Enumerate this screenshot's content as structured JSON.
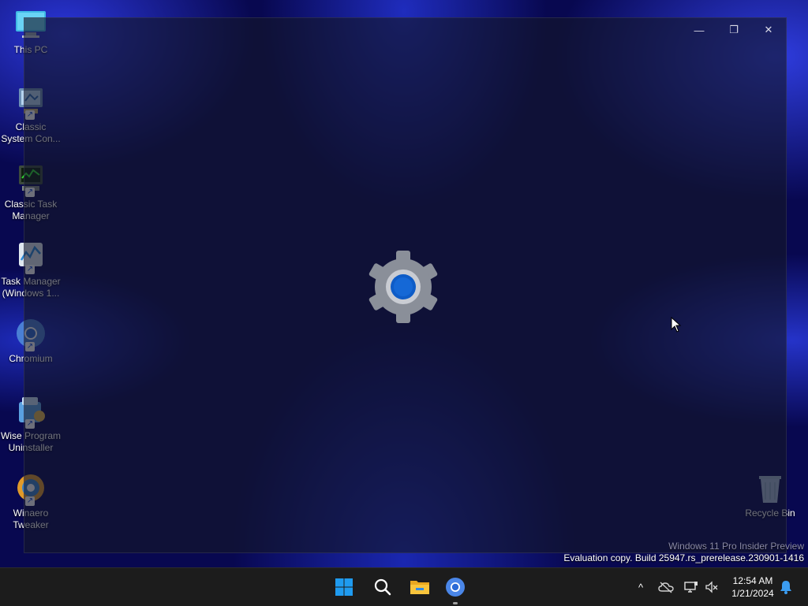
{
  "desktop": {
    "icons": [
      {
        "label": "This PC",
        "icon": "this-pc-icon"
      },
      {
        "label": "Classic System Con...",
        "icon": "control-panel-icon"
      },
      {
        "label": "Classic Task Manager",
        "icon": "classic-task-manager-icon"
      },
      {
        "label": "Task Manager (Windows 1...",
        "icon": "task-manager-icon"
      },
      {
        "label": "Chromium",
        "icon": "chromium-icon"
      },
      {
        "label": "Wise Program Uninstaller",
        "icon": "uninstaller-icon"
      },
      {
        "label": "Winaero Tweaker",
        "icon": "winaero-icon"
      }
    ],
    "recycle_bin": {
      "label": "Recycle Bin",
      "icon": "recycle-bin-icon"
    }
  },
  "window": {
    "app": "Settings",
    "splash_icon": "settings-gear-icon",
    "controls": {
      "minimize": "—",
      "restore": "❐",
      "close": "✕"
    }
  },
  "watermark": {
    "line1": "Windows 11 Pro Insider Preview",
    "line2": "Evaluation copy. Build 25947.rs_prerelease.230901-1416"
  },
  "taskbar": {
    "pinned": [
      {
        "name": "Start",
        "icon": "windows-start-icon"
      },
      {
        "name": "Search",
        "icon": "search-icon"
      },
      {
        "name": "File Explorer",
        "icon": "file-explorer-icon"
      },
      {
        "name": "Chromium",
        "icon": "chromium-icon",
        "active": true
      }
    ],
    "tray": {
      "chevron": "^",
      "time": "12:54 AM",
      "date": "1/21/2024"
    }
  },
  "colors": {
    "accent": "#0067c0",
    "taskbar_bg": "#1c1c1c",
    "wallpaper": "#0a0a5e"
  }
}
